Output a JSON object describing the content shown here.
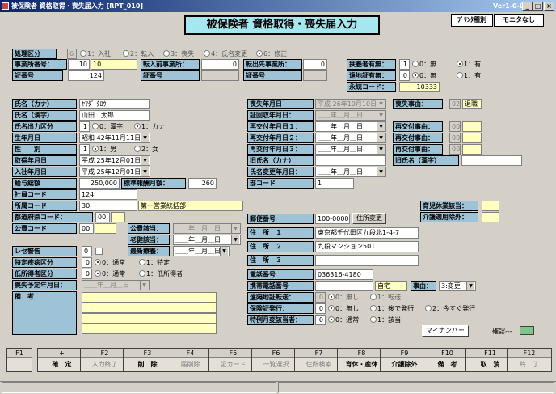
{
  "window": {
    "title": "被保険者 資格取得・喪失届入力 [RPT_010]",
    "version": "Ver1-0-0",
    "min": "_",
    "max": "□",
    "close": "×"
  },
  "header": {
    "title": "被保険者 資格取得・喪失届入力",
    "print_type": "ﾌﾟﾘﾝﾀ種別",
    "monitor": "モニタなし"
  },
  "row1": {
    "label": "処理区分",
    "code": "6",
    "options": [
      "1：入社",
      "2：転入",
      "3：喪失",
      "4：氏名変更",
      "6：修正"
    ]
  },
  "row2": {
    "office_no_label": "事業所番号：",
    "office_no_1": "10",
    "office_no_2": "10",
    "prev_office_label": "転入前事業所：",
    "prev_office": "0",
    "out_office_label": "転出先事業所：",
    "out_office": "0",
    "dependent_label": "扶養者有無：",
    "dependent_code": "1",
    "dependent_opt0": "0：無",
    "dependent_opt1": "1：有"
  },
  "row3": {
    "cert_label": "証番号",
    "cert_no": "124",
    "cert2_label": "証番号",
    "cert3_label": "証番号",
    "remote_label": "遠地証有無：",
    "remote_code": "0",
    "remote_opt0": "0：無",
    "remote_opt1": "1：有"
  },
  "row4": {
    "perm_label": "永続コード：",
    "perm_code": "10333"
  },
  "left": {
    "kana_label": "氏名（カナ）",
    "kana": "ﾔﾏﾀﾞ ﾀﾛｳ",
    "kanji_label": "氏名（漢字）",
    "kanji": "山田　太郎",
    "out_label": "氏名出力区分",
    "out_code": "1",
    "out_opt0": "0：漢字",
    "out_opt1": "1：カナ",
    "birth_label": "生年月日",
    "birth": "昭和 42年11月11日",
    "sex_label": "性　　別",
    "sex_code": "1",
    "sex_opt1": "1：男",
    "sex_opt2": "2：女",
    "acq_label": "取得年月日",
    "acq": "平成 25年12月01日",
    "join_label": "入社年月日",
    "join": "平成 25年12月01日",
    "salary_label": "給与総額",
    "salary": "250,000",
    "std_label": "標準報酬月額：",
    "std": "260",
    "emp_label": "社員コード",
    "emp": "124",
    "dept_label": "所属コード",
    "dept_code": "30",
    "dept_name": "第一営業統括部",
    "pref_label": "都道府県コード：",
    "pref": "00",
    "public_label": "公費コード",
    "public": "00",
    "public_app_label": "公費該当：",
    "public_app": "＿＿年＿月＿日",
    "elder_label": "老健該当：",
    "elder": "＿＿年＿月＿日",
    "latest_label": "最新療養：",
    "latest": "＿＿年＿月＿日",
    "rece_label": "レセ警告",
    "rece": "0",
    "disease_label": "特定疾病区分",
    "disease_code": "0",
    "disease_opt0": "0：通常",
    "disease_opt1": "1：特定",
    "low_label": "低所得者区分",
    "low_code": "0",
    "low_opt0": "0：通常",
    "low_opt1": "1：低所得者",
    "plan_label": "喪失予定年月日：",
    "plan": "＿＿年＿月＿日",
    "note_label": "備　考"
  },
  "right": {
    "loss_label": "喪失年月日",
    "loss": "平成 26年10月10日",
    "reason_label": "喪失事由：",
    "reason_code": "02",
    "reason_name": "退職",
    "recv_label": "証回収年月日：",
    "recv": "＿＿年＿月＿日",
    "reissue1_label": "再交付年月日１：",
    "reissue1": "＿＿年＿月＿日",
    "re1_reason_label": "再交付事由：",
    "re1_code": "00",
    "reissue2_label": "再交付年月日２：",
    "reissue2": "＿＿年＿月＿日",
    "re2_reason_label": "再交付事由：",
    "re2_code": "00",
    "reissue3_label": "再交付年月日３：",
    "reissue3": "＿＿年＿月＿日",
    "re3_reason_label": "再交付事由：",
    "re3_code": "00",
    "old_kana_label": "旧氏名（カナ）",
    "old_kanji_label": "旧氏名（漢字）",
    "name_change_label": "氏名変更年月日：",
    "name_change": "＿＿年＿月＿日",
    "part_label": "部コード",
    "part": "1",
    "childcare_label": "育児休業該当：",
    "care_ex_label": "介護適用除外：",
    "zip_label": "郵便番号",
    "zip": "100-0000",
    "zip_btn": "住所変更",
    "addr1_label": "住　所　１",
    "addr1": "東京都千代田区九段北1-4-7",
    "addr2_label": "住　所　２",
    "addr2": "九段マンション501",
    "addr3_label": "住　所　３",
    "phone_label": "電話番号",
    "phone": "036316-4180",
    "mobile_label": "携帯電話番号",
    "mobile_type": "自宅",
    "event_label": "事由：",
    "event": "3:変更",
    "remote_label": "遠隔地証転送：",
    "remote_code": "0",
    "remote_opt0": "0：無し",
    "remote_opt1": "1：転送",
    "issue_label": "保険証発行：",
    "issue_code": "0",
    "issue_opt0": "0：無し",
    "issue_opt1": "1：後で発行",
    "issue_opt2": "2：今すぐ発行",
    "special_label": "特例月変該当者：",
    "special_code": "0",
    "special_opt0": "0：通常",
    "special_opt1": "1：該当",
    "mynumber_btn": "マイナンバー",
    "confirm_label": "確認---"
  },
  "fkeys": [
    {
      "key": "F1",
      "label": ""
    },
    {
      "key": "+",
      "label": "確　定"
    },
    {
      "key": "F2",
      "label": "入力終了"
    },
    {
      "key": "F3",
      "label": "削　除"
    },
    {
      "key": "F4",
      "label": "届削除"
    },
    {
      "key": "F5",
      "label": "証カード"
    },
    {
      "key": "F6",
      "label": "一覧選択"
    },
    {
      "key": "F7",
      "label": "住所検索"
    },
    {
      "key": "F8",
      "label": "育休・産休"
    },
    {
      "key": "F9",
      "label": "介護除外"
    },
    {
      "key": "F10",
      "label": "備　考"
    },
    {
      "key": "F11",
      "label": "取　消"
    },
    {
      "key": "F12",
      "label": "終　了"
    }
  ]
}
